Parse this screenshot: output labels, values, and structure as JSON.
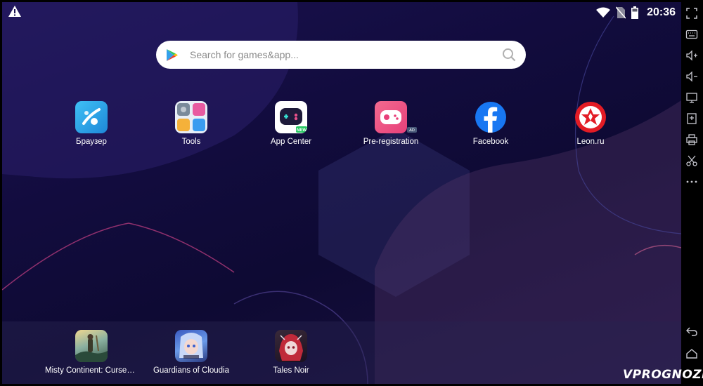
{
  "status_bar": {
    "time": "20:36",
    "icons": [
      "warning-icon",
      "wifi-icon",
      "no-sim-icon",
      "battery-icon"
    ]
  },
  "search": {
    "placeholder": "Search for games&app..."
  },
  "apps": [
    {
      "label": "Браузер",
      "icon": "browser-icon",
      "color": "#2fa6ea"
    },
    {
      "label": "Tools",
      "icon": "tools-folder-icon",
      "color": "#e8eef6"
    },
    {
      "label": "App Center",
      "icon": "app-center-icon",
      "color": "#ffffff",
      "badge": "NEW"
    },
    {
      "label": "Pre-registration",
      "icon": "pre-registration-icon",
      "color": "#ee4d7a",
      "badge": "AD"
    },
    {
      "label": "Facebook",
      "icon": "facebook-icon",
      "color": "#1877f2"
    },
    {
      "label": "Leon.ru",
      "icon": "leon-icon",
      "color": "#e31c25"
    }
  ],
  "dock_apps": [
    {
      "label": "Misty Continent: Cursed Isla...",
      "icon": "misty-continent-icon"
    },
    {
      "label": "Guardians of Cloudia",
      "icon": "guardians-of-cloudia-icon"
    },
    {
      "label": "Tales Noir",
      "icon": "tales-noir-icon"
    }
  ],
  "side_panel": {
    "buttons": [
      "fullscreen-icon",
      "keyboard-icon",
      "volume-up-icon",
      "volume-down-icon",
      "screen-icon",
      "install-apk-icon",
      "printer-icon",
      "scissors-icon",
      "more-icon",
      "back-icon",
      "home-icon"
    ]
  },
  "watermark": "VPROGNOZE"
}
